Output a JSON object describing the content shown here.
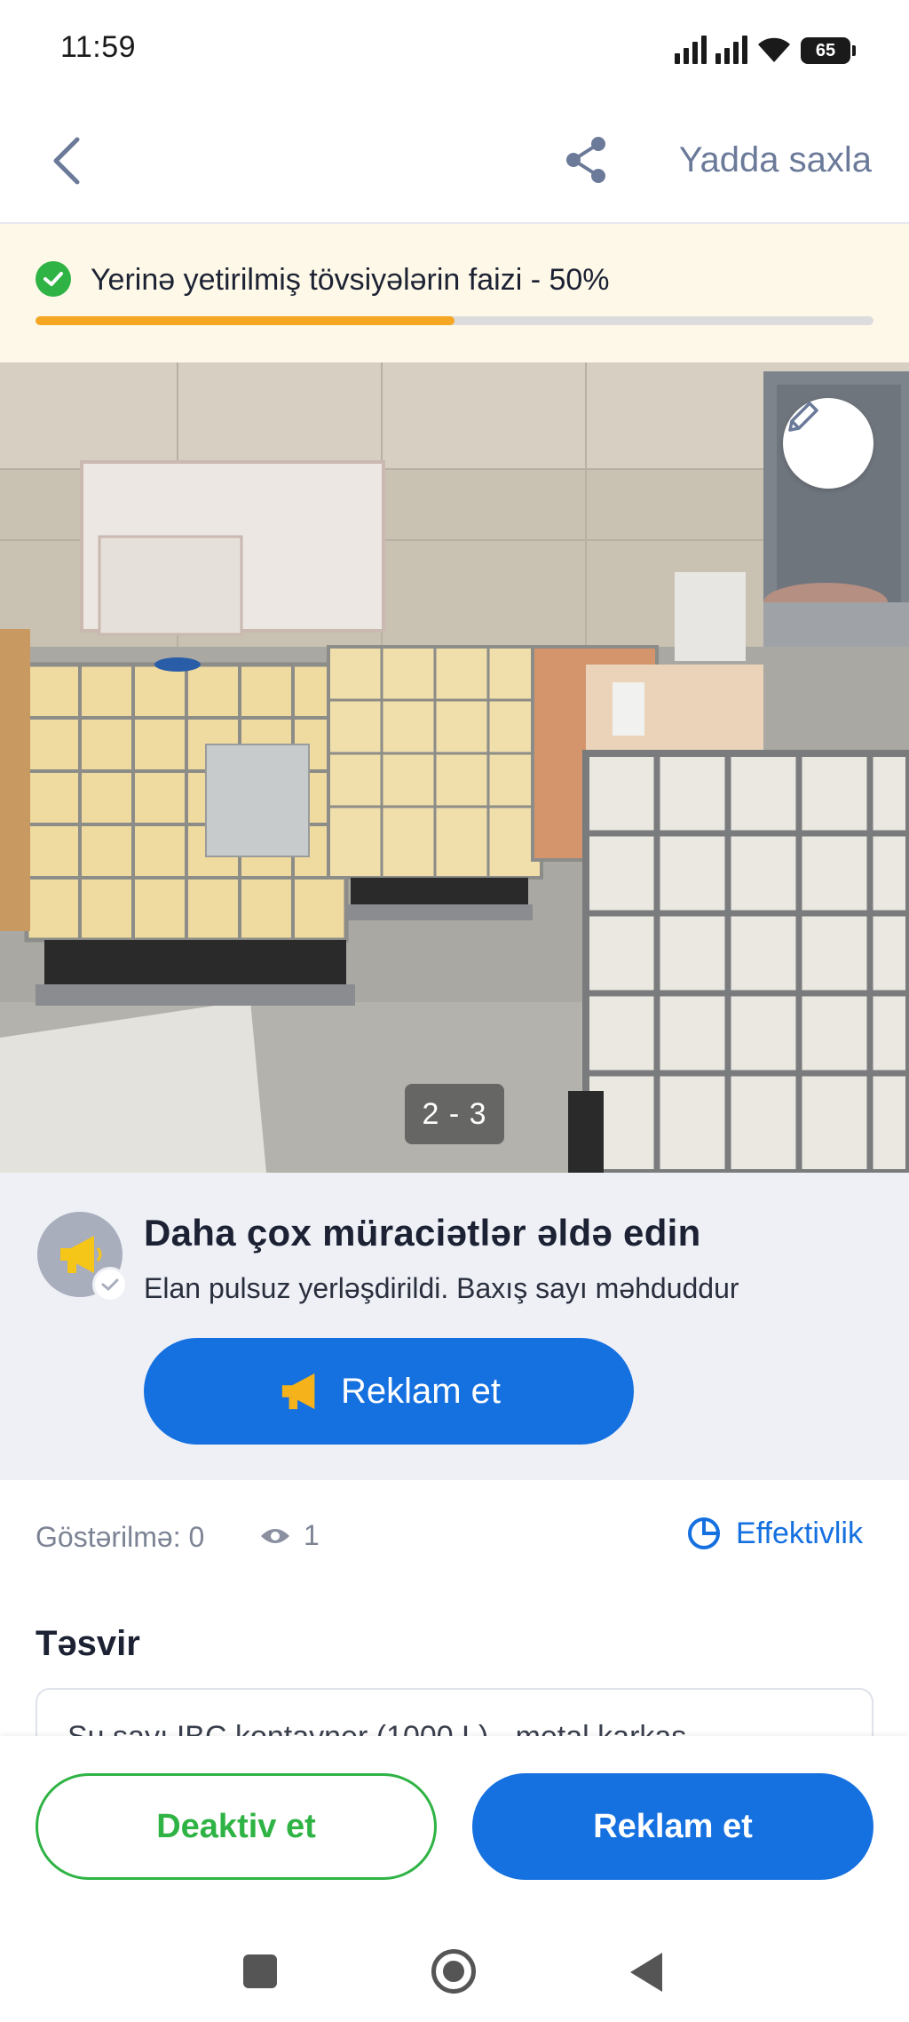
{
  "status_bar": {
    "time": "11:59",
    "battery": "65"
  },
  "topnav": {
    "back_icon": "chevron-left-icon",
    "share_icon": "share-icon",
    "save_label": "Yadda saxla"
  },
  "progress": {
    "text": "Yerinə yetirilmiş tövsiyələrin faizi - 50%",
    "value": 0.5,
    "fill_color": "#f5a623",
    "check_color": "#2fb344"
  },
  "photo": {
    "counter": "2 - 3",
    "edit_icon": "pencil-icon"
  },
  "promo": {
    "title": "Daha çox müraciətlər əldə edin",
    "subtitle": "Elan pulsuz yerləşdirildi. Baxış sayı məhduddur",
    "button_label": "Reklam et",
    "icon": "megaphone-icon"
  },
  "stats": {
    "impressions": "Göstərilmə: 0",
    "views": "1",
    "views_icon": "eye-icon",
    "effectiveness": "Effektivlik",
    "effectiveness_icon": "pie-chart-icon"
  },
  "description": {
    "title": "Təsvir",
    "text": "Su sayı IBC kontayner (1000 L) - metal karkas..."
  },
  "bottom_actions": {
    "deactivate": "Deaktiv et",
    "advertise": "Reklam et"
  },
  "colors": {
    "primary": "#1570e0",
    "success": "#2fb344",
    "banner_bg": "#fef8e8",
    "promo_bg": "#eef0f6"
  }
}
